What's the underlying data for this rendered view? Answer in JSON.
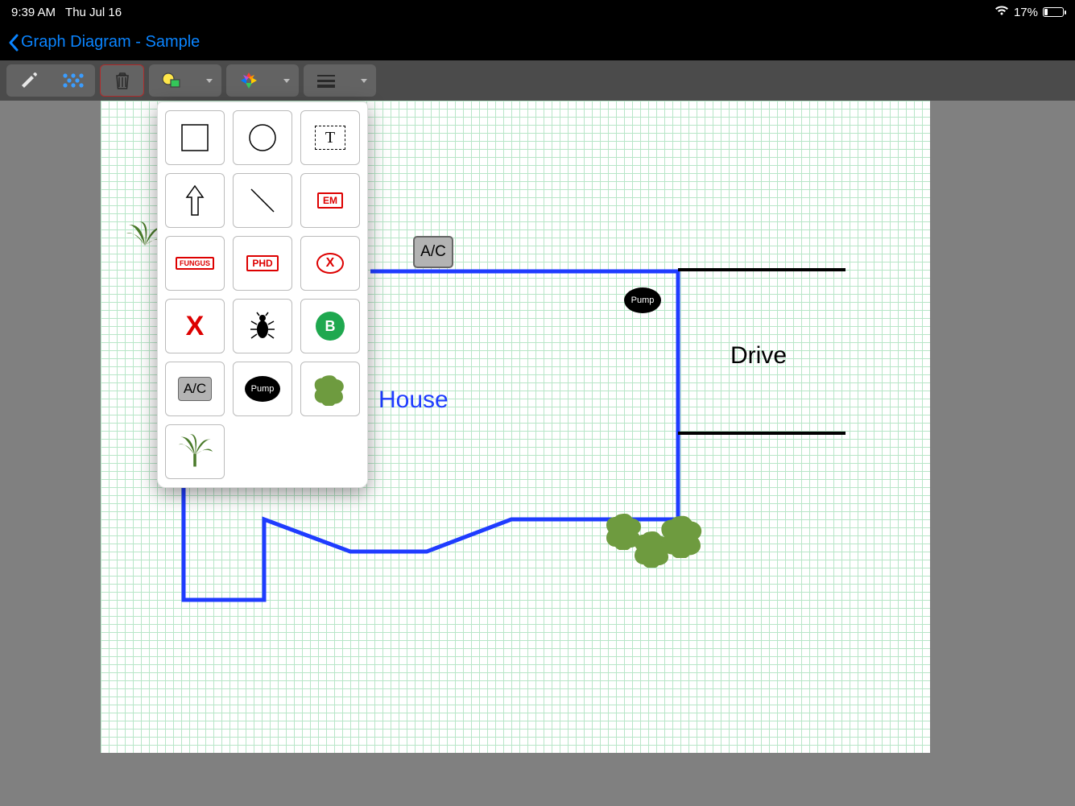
{
  "status": {
    "time": "9:39 AM",
    "date": "Thu Jul 16",
    "battery_pct": "17%"
  },
  "nav": {
    "back_label": "Graph Diagram - Sample"
  },
  "palette": {
    "items": {
      "square_label": "",
      "circle_label": "",
      "text_label": "T",
      "arrow_label": "",
      "line_label": "",
      "em_label": "EM",
      "fungus_label": "FUNGUS",
      "phd_label": "PHD",
      "ovalx_label": "X",
      "bigx_label": "X",
      "bug_label": "",
      "b_label": "B",
      "ac_label": "A/C",
      "pump_label": "Pump",
      "bush_label": "",
      "palm_label": ""
    }
  },
  "canvas": {
    "ac_label": "A/C",
    "pump_label": "Pump",
    "house_label": "House",
    "drive_label": "Drive"
  },
  "colors": {
    "accent_blue": "#0a84ff",
    "house_line": "#1f3cff",
    "drive_line": "#000000",
    "grid_minor": "#b8e6c8",
    "grid_major": "#7fd39a",
    "bush_green": "#6e9b3f"
  }
}
